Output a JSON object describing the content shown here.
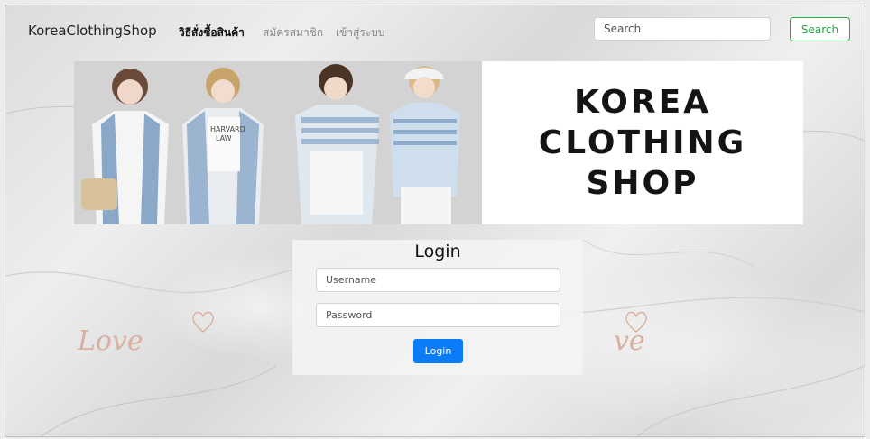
{
  "navbar": {
    "brand": "KoreaClothingShop",
    "links": [
      {
        "label": "วิธีสั่งซื้อสินค้า",
        "active": true
      },
      {
        "label": "สมัครสมาชิก",
        "active": false
      },
      {
        "label": "เข้าสู่ระบบ",
        "active": false
      }
    ],
    "search_placeholder": "Search",
    "search_button": "Search"
  },
  "banner": {
    "lines": [
      "KOREA",
      "CLOTHING",
      "SHOP"
    ],
    "shirt_print": "HARVARD LAW"
  },
  "login": {
    "title": "Login",
    "username_placeholder": "Username",
    "password_placeholder": "Password",
    "button": "Login"
  },
  "decor": {
    "script_word": "Love"
  },
  "colors": {
    "accent": "#0a7cf8",
    "success": "#28a745",
    "background": "#e6e6e6"
  }
}
